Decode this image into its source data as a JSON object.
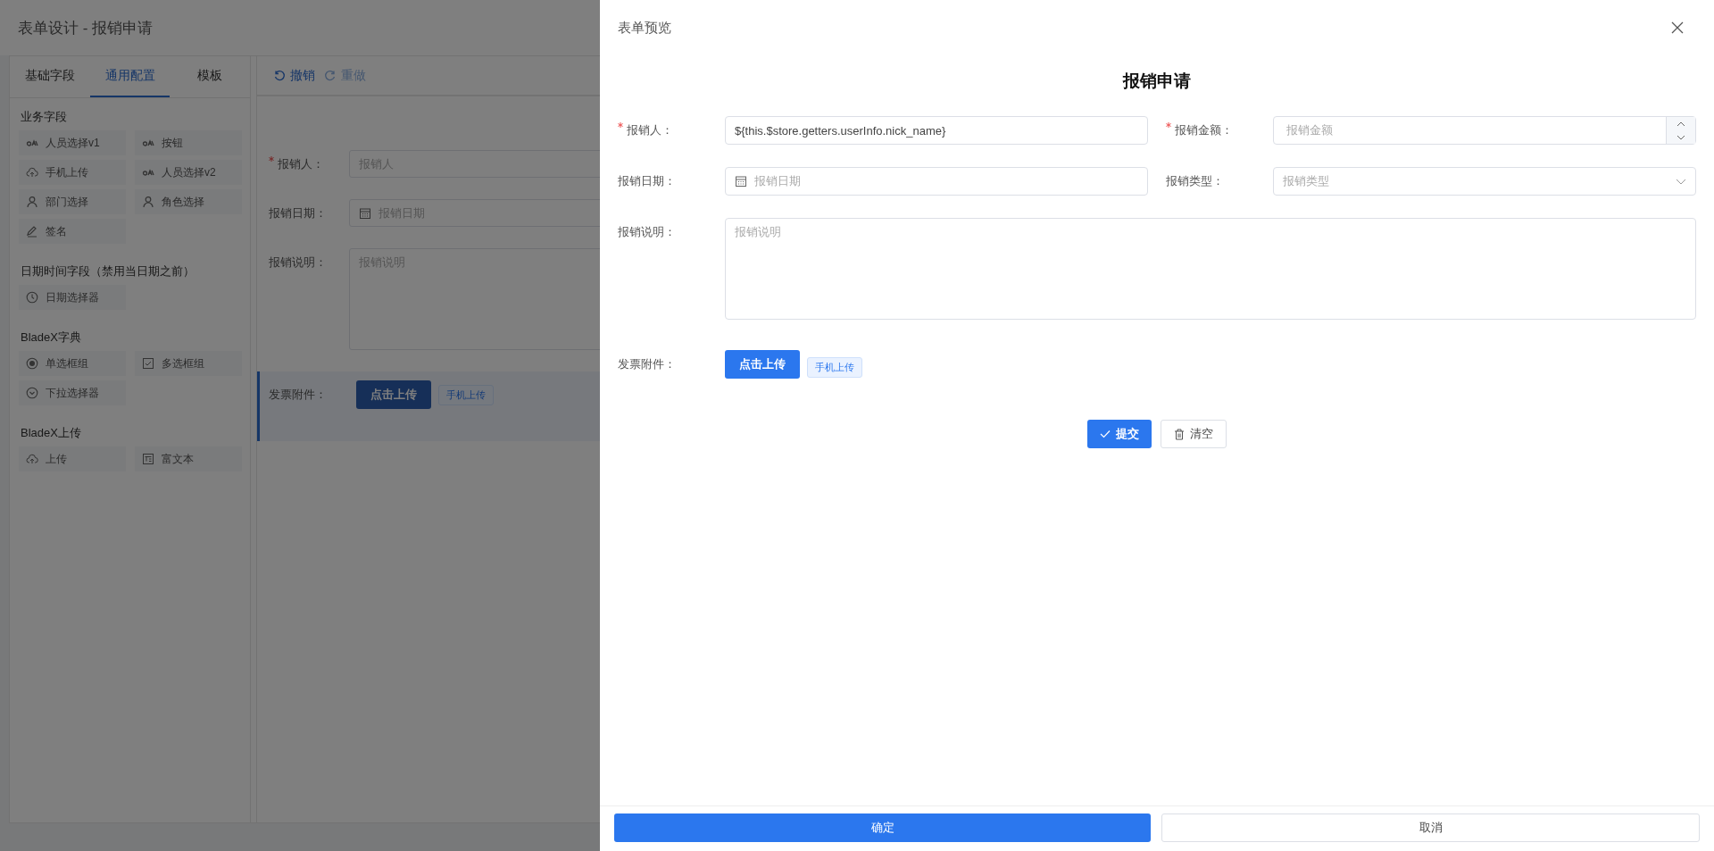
{
  "page": {
    "title": "表单设计 - 报销申请"
  },
  "palette": {
    "tabs": [
      {
        "label": "基础字段",
        "selected": false
      },
      {
        "label": "通用配置",
        "selected": true
      },
      {
        "label": "模板",
        "selected": false
      }
    ],
    "groups": [
      {
        "title": "业务字段",
        "items": [
          {
            "label": "人员选择v1",
            "kind": "link"
          },
          {
            "label": "按钮",
            "kind": "link"
          },
          {
            "label": "手机上传",
            "kind": "cloud"
          },
          {
            "label": "人员选择v2",
            "kind": "link"
          },
          {
            "label": "部门选择",
            "kind": "person"
          },
          {
            "label": "角色选择",
            "kind": "person"
          },
          {
            "label": "签名",
            "kind": "pen"
          }
        ]
      },
      {
        "title": "日期时间字段（禁用当日期之前）",
        "items": [
          {
            "label": "日期选择器",
            "kind": "clock"
          }
        ]
      },
      {
        "title": "BladeX字典",
        "items": [
          {
            "label": "单选框组",
            "kind": "radio"
          },
          {
            "label": "多选框组",
            "kind": "checkbox"
          },
          {
            "label": "下拉选择器",
            "kind": "chevron"
          }
        ]
      },
      {
        "title": "BladeX上传",
        "items": [
          {
            "label": "上传",
            "kind": "cloud"
          },
          {
            "label": "富文本",
            "kind": "richtext"
          }
        ]
      }
    ]
  },
  "canvas": {
    "toolbar": [
      {
        "label": "撤销",
        "kind": "undo",
        "disabled": false
      },
      {
        "label": "重做",
        "kind": "redo",
        "disabled": true
      }
    ],
    "fields": [
      {
        "kind": "text",
        "label": "报销人：",
        "required": true,
        "placeholder": "报销人",
        "selected": false
      },
      {
        "kind": "date",
        "label": "报销日期：",
        "required": false,
        "placeholder": "报销日期",
        "selected": false
      },
      {
        "kind": "textarea",
        "label": "报销说明：",
        "required": false,
        "placeholder": "报销说明",
        "selected": false
      },
      {
        "kind": "upload",
        "label": "发票附件：",
        "required": false,
        "button": "点击上传",
        "tag": "手机上传",
        "selected": true
      }
    ]
  },
  "drawer": {
    "title": "表单预览",
    "form_title": "报销申请",
    "fields": [
      {
        "kind": "text",
        "label": "报销人：",
        "required": true,
        "value": "${this.$store.getters.userInfo.nick_name}"
      },
      {
        "kind": "number",
        "label": "报销金额：",
        "required": true,
        "placeholder": "报销金额"
      },
      {
        "kind": "date",
        "label": "报销日期：",
        "required": false,
        "placeholder": "报销日期"
      },
      {
        "kind": "select",
        "label": "报销类型：",
        "required": false,
        "placeholder": "报销类型"
      },
      {
        "kind": "textarea",
        "label": "报销说明：",
        "required": false,
        "placeholder": "报销说明"
      },
      {
        "kind": "upload",
        "label": "发票附件：",
        "required": false,
        "button": "点击上传",
        "tag": "手机上传"
      }
    ],
    "submit": "提交",
    "clear": "清空",
    "confirm": "确定",
    "cancel": "取消"
  }
}
